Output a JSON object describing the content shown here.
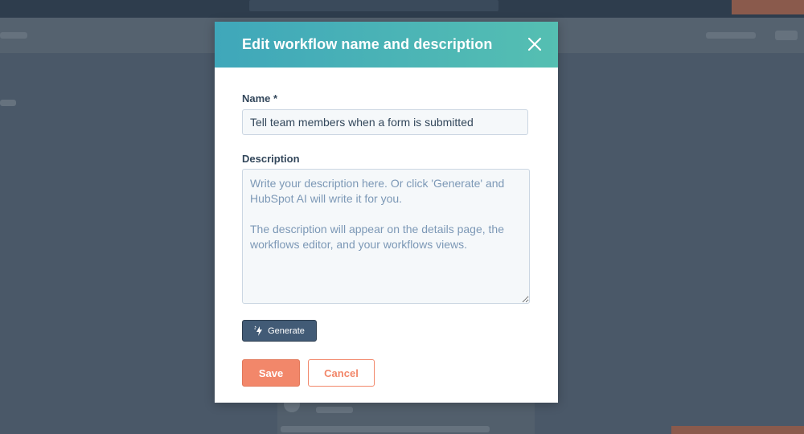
{
  "modal": {
    "title": "Edit workflow name and description",
    "name_label": "Name *",
    "name_value": "Tell team members when a form is submitted",
    "description_label": "Description",
    "description_placeholder": "Write your description here. Or click 'Generate' and HubSpot AI will write it for you.\n\nThe description will appear on the details page, the workflows editor, and your workflows views.",
    "description_value": "",
    "generate_label": "Generate",
    "save_label": "Save",
    "cancel_label": "Cancel"
  },
  "icons": {
    "close": "close-icon",
    "generate": "sparkle-bolt-icon",
    "resize": "resize-handle-icon"
  },
  "colors": {
    "header_gradient_start": "#3fa7ba",
    "header_gradient_end": "#55bfb2",
    "primary_accent": "#f2876a",
    "secondary_button": "#425b76",
    "text": "#33475b",
    "backdrop": "#4a5868"
  }
}
